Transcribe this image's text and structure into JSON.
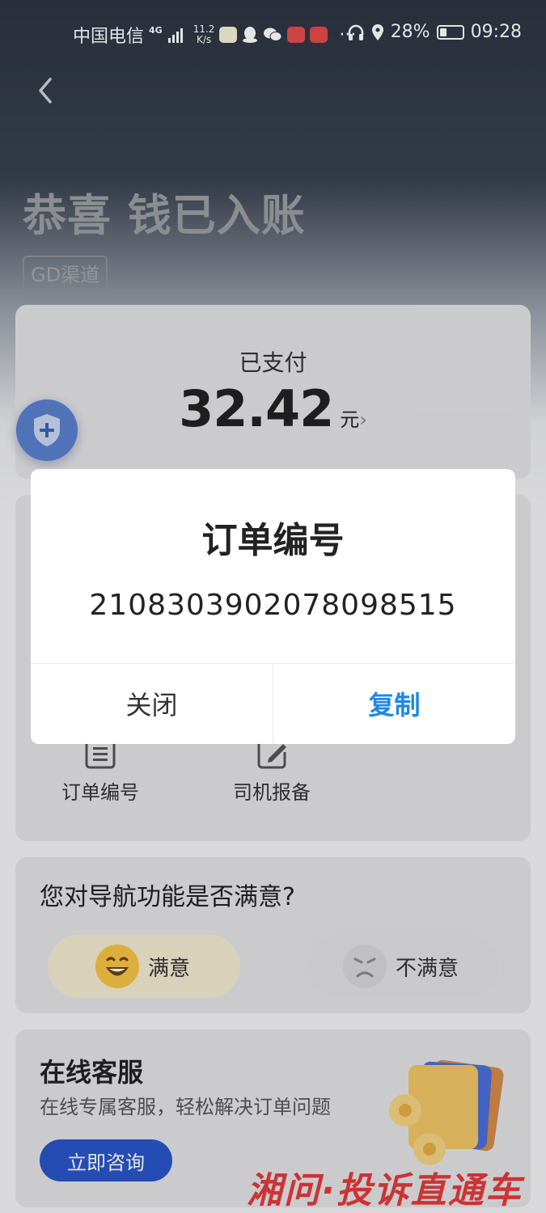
{
  "status_bar": {
    "carrier": "中国电信",
    "network": "4G",
    "net_speed_value": "11.2",
    "net_speed_unit": "K/s",
    "more": "···",
    "battery": "28%",
    "time": "09:28"
  },
  "header": {
    "title": "恭喜 钱已入账",
    "channel_tag": "GD渠道"
  },
  "payment": {
    "label": "已支付",
    "amount": "32.42",
    "unit": "元",
    "chevron": "›"
  },
  "actions": [
    {
      "label": "订单编号",
      "icon": "document-icon"
    },
    {
      "label": "司机报备",
      "icon": "edit-icon"
    }
  ],
  "survey": {
    "question": "您对导航功能是否满意?",
    "satisfied": "满意",
    "unsatisfied": "不满意"
  },
  "customer_service": {
    "title": "在线客服",
    "subtitle": "在线专属客服，轻松解决订单问题",
    "button": "立即咨询"
  },
  "dialog": {
    "title": "订单编号",
    "value": "2108303902078098515",
    "close": "关闭",
    "copy": "复制"
  },
  "watermark": "湘问·投诉直通车",
  "colors": {
    "accent_blue": "#1e88e5",
    "button_blue": "#2a55c8",
    "header_dark": "#2d3441",
    "watermark_red": "#e23a3a"
  }
}
